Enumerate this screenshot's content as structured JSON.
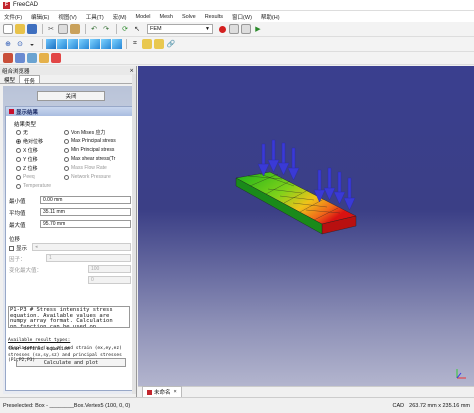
{
  "window": {
    "title": "FreeCAD",
    "app_icon": "freecad-icon"
  },
  "menu": [
    "文件(F)",
    "编辑(E)",
    "视图(V)",
    "工具(T)",
    "宏(M)",
    "Model",
    "Mesh",
    "Solve",
    "Results",
    "窗口(W)",
    "帮助(H)"
  ],
  "toolbar": {
    "workbench": "FEM"
  },
  "combo_view": {
    "title": "组合浏览器",
    "tabs": [
      "模型",
      "任务"
    ],
    "close_button": "关闭"
  },
  "results_panel": {
    "title": "显示结果",
    "result_type_label": "结果类型",
    "options_left": [
      "无",
      "绝对位移",
      "X 位移",
      "Y 位移",
      "Z 位移",
      "Peeq",
      "Temperature"
    ],
    "options_right": [
      "Von Mises 应力",
      "Max Principal stress",
      "Min Principal stress",
      "Max shear stress(Tr",
      "Mass Flow Rate",
      "Network Pressure"
    ],
    "min_label": "最小值",
    "min_value": "0.00 mm",
    "avg_label": "平均值",
    "avg_value": "35.11 mm",
    "max_label": "最大值",
    "max_value": "95.70 mm",
    "displacement_label": "位移",
    "show_label": "显示",
    "factor_label": "因子：",
    "factor_value": "1",
    "slider_max_label": "变化最大值：",
    "slider_max_value": "100",
    "slider_min_value": "0",
    "equation_label": "User defined equation",
    "calc_button": "Calculate and plot",
    "equation_text": "P1-P3 # Stress intensity stress equation. Available values are numpy array format. Calculation np.function can be used on available values.",
    "available_label": "Available result types:",
    "avail_line1": "displacement (x,y,z) and strain (ex,ey,ez)",
    "avail_line2": "stresses (sx,sy,sz) and principal stresses (P1,P2,P3)"
  },
  "document_tab": "未命名",
  "status": {
    "preselected": "Preselected: Box - ________Box.Vertex5 (100, 0, 0)",
    "nav": "CAD",
    "dims": "263.72 mm x 235.16 mm"
  },
  "colors": {
    "viewport_top": "#3a3f8f",
    "viewport_bottom": "#b3b5ce",
    "arrow": "#3a3ad6"
  }
}
